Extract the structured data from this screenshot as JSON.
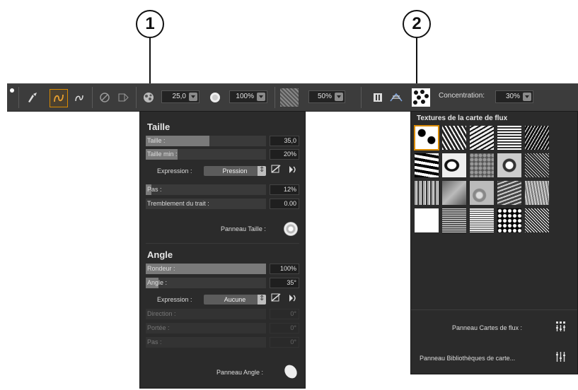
{
  "callouts": [
    "1",
    "2"
  ],
  "toolbar": {
    "size_value": "25,0",
    "opacity_value": "100%",
    "texture_pct": "50%",
    "concentration_label": "Concentration:",
    "concentration_value": "30%",
    "icons": [
      "brush-tool-icon",
      "dynamic-speckles-icon",
      "stroke-attributes-icon",
      "eraser-icon",
      "transform-icon",
      "brush-size-icon",
      "opacity-icon",
      "paper-texture-icon",
      "pause-icon",
      "flow-map-icon",
      "flow-map-texture-icon"
    ]
  },
  "size_panel": {
    "title": "Taille",
    "rows": [
      {
        "label": "Taille :",
        "value": "35,0"
      },
      {
        "label": "Taille min :",
        "value": "20%"
      }
    ],
    "expression_label": "Expression :",
    "expression_value": "Pression",
    "rows2": [
      {
        "label": "Pas :",
        "value": "12%"
      },
      {
        "label": "Tremblement du trait :",
        "value": "0.00"
      }
    ],
    "panel_link": "Panneau Taille :"
  },
  "angle_panel": {
    "title": "Angle",
    "rows": [
      {
        "label": "Rondeur :",
        "value": "100%"
      },
      {
        "label": "Angle :",
        "value": "35°"
      }
    ],
    "expression_label": "Expression :",
    "expression_value": "Aucune",
    "disabled_rows": [
      {
        "label": "Direction :",
        "value": "0°"
      },
      {
        "label": "Portée :",
        "value": "0°"
      },
      {
        "label": "Pas :",
        "value": "0°"
      }
    ],
    "panel_link": "Panneau Angle :"
  },
  "flow_panel": {
    "title": "Textures de la carte de flux",
    "link1": "Panneau Cartes de flux :",
    "link2": "Panneau Bibliothèques de carte..."
  }
}
